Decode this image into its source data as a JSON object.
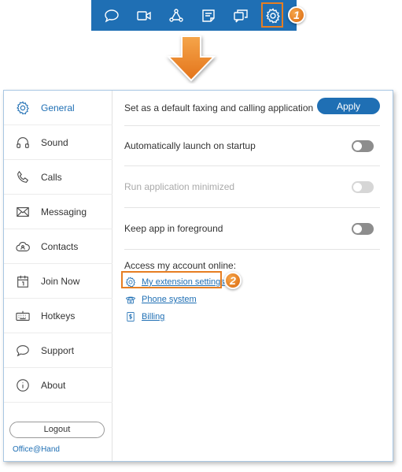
{
  "toolbar": {
    "icons": [
      "chat-icon",
      "video-icon",
      "conference-icon",
      "notes-icon",
      "messages-icon",
      "settings-icon"
    ],
    "accent": "#1f6fb4",
    "highlight_color": "#e67e22"
  },
  "callouts": {
    "step1": "1",
    "step2": "2"
  },
  "sidebar": {
    "items": [
      {
        "label": "General",
        "icon": "gear-icon",
        "active": true
      },
      {
        "label": "Sound",
        "icon": "headphones-icon"
      },
      {
        "label": "Calls",
        "icon": "phone-icon"
      },
      {
        "label": "Messaging",
        "icon": "envelope-icon"
      },
      {
        "label": "Contacts",
        "icon": "cloud-contacts-icon"
      },
      {
        "label": "Join Now",
        "icon": "calendar-icon"
      },
      {
        "label": "Hotkeys",
        "icon": "keyboard-icon"
      },
      {
        "label": "Support",
        "icon": "speech-bubble-icon"
      },
      {
        "label": "About",
        "icon": "info-icon"
      }
    ],
    "logout_label": "Logout",
    "brand": "Office@Hand"
  },
  "general": {
    "default_app_label": "Set as a default faxing and calling application",
    "apply_label": "Apply",
    "settings": [
      {
        "label": "Automatically launch on startup",
        "enabled": false,
        "disabled": false
      },
      {
        "label": "Run application minimized",
        "enabled": false,
        "disabled": true
      },
      {
        "label": "Keep app in foreground",
        "enabled": false,
        "disabled": false
      }
    ],
    "access_title": "Access my account online:",
    "links": [
      {
        "label": "My extension settings",
        "icon": "gear-icon"
      },
      {
        "label": "Phone system",
        "icon": "phone-system-icon"
      },
      {
        "label": "Billing",
        "icon": "billing-icon"
      }
    ]
  }
}
